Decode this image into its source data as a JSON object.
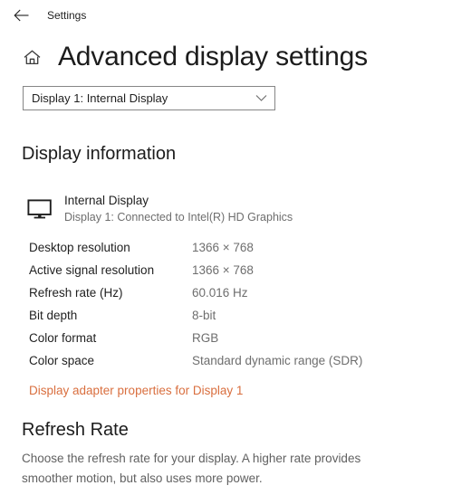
{
  "titlebar": {
    "back_icon": "back-arrow-icon",
    "breadcrumb": "Settings"
  },
  "header": {
    "home_icon": "home-icon",
    "title": "Advanced display settings"
  },
  "display_selector": {
    "selected": "Display 1: Internal Display",
    "chevron_icon": "chevron-down-icon",
    "options": [
      "Display 1: Internal Display"
    ]
  },
  "display_information": {
    "heading": "Display information",
    "device": {
      "icon": "monitor-icon",
      "name": "Internal Display",
      "subtitle": "Display 1: Connected to Intel(R) HD Graphics"
    },
    "rows": [
      {
        "label": "Desktop resolution",
        "value": "1366 × 768"
      },
      {
        "label": "Active signal resolution",
        "value": "1366 × 768"
      },
      {
        "label": "Refresh rate (Hz)",
        "value": "60.016 Hz"
      },
      {
        "label": "Bit depth",
        "value": "8-bit"
      },
      {
        "label": "Color format",
        "value": "RGB"
      },
      {
        "label": "Color space",
        "value": "Standard dynamic range (SDR)"
      }
    ],
    "adapter_link": "Display adapter properties for Display 1"
  },
  "refresh_rate": {
    "heading": "Refresh Rate",
    "description": "Choose the refresh rate for your display. A higher rate provides smoother motion, but also uses more power."
  },
  "colors": {
    "accent_link": "#d96f3f",
    "background": "#ffffff",
    "label_text": "#1f1f1f",
    "value_text": "#6e6e6e"
  }
}
